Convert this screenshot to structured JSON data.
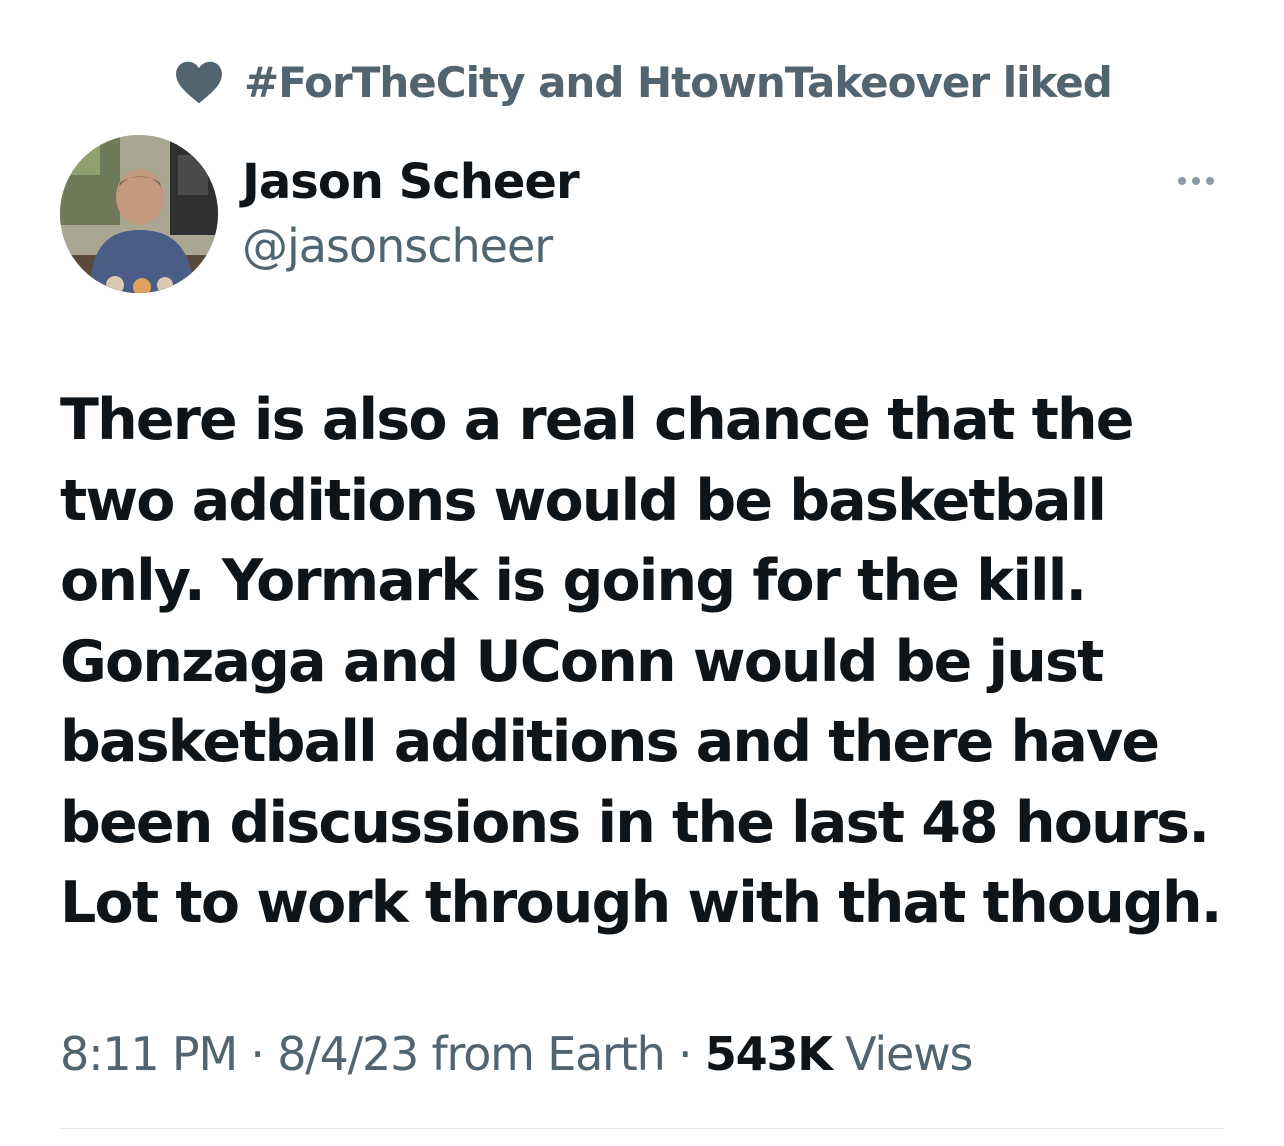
{
  "social_context": {
    "icon": "heart-icon",
    "text": "#ForTheCity and HtownTakeover liked"
  },
  "author": {
    "display_name": "Jason Scheer",
    "handle": "@jasonscheer",
    "avatar": "profile-photo"
  },
  "more_icon": "more-horizontal-icon",
  "tweet": {
    "text": "There is also a real chance that the two additions would be basketball only. Yormark is going for the kill. Gonzaga and UConn would be just basketball additions and there have been discussions in the last 48 hours. Lot to work through with that though."
  },
  "meta": {
    "time": "8:11 PM",
    "separator": " · ",
    "date": "8/4/23",
    "source": " from Earth",
    "views_count": "543K",
    "views_label": " Views"
  },
  "colors": {
    "primary_text": "#0f1419",
    "secondary_text": "#536471",
    "divider": "#e1e6ea"
  }
}
